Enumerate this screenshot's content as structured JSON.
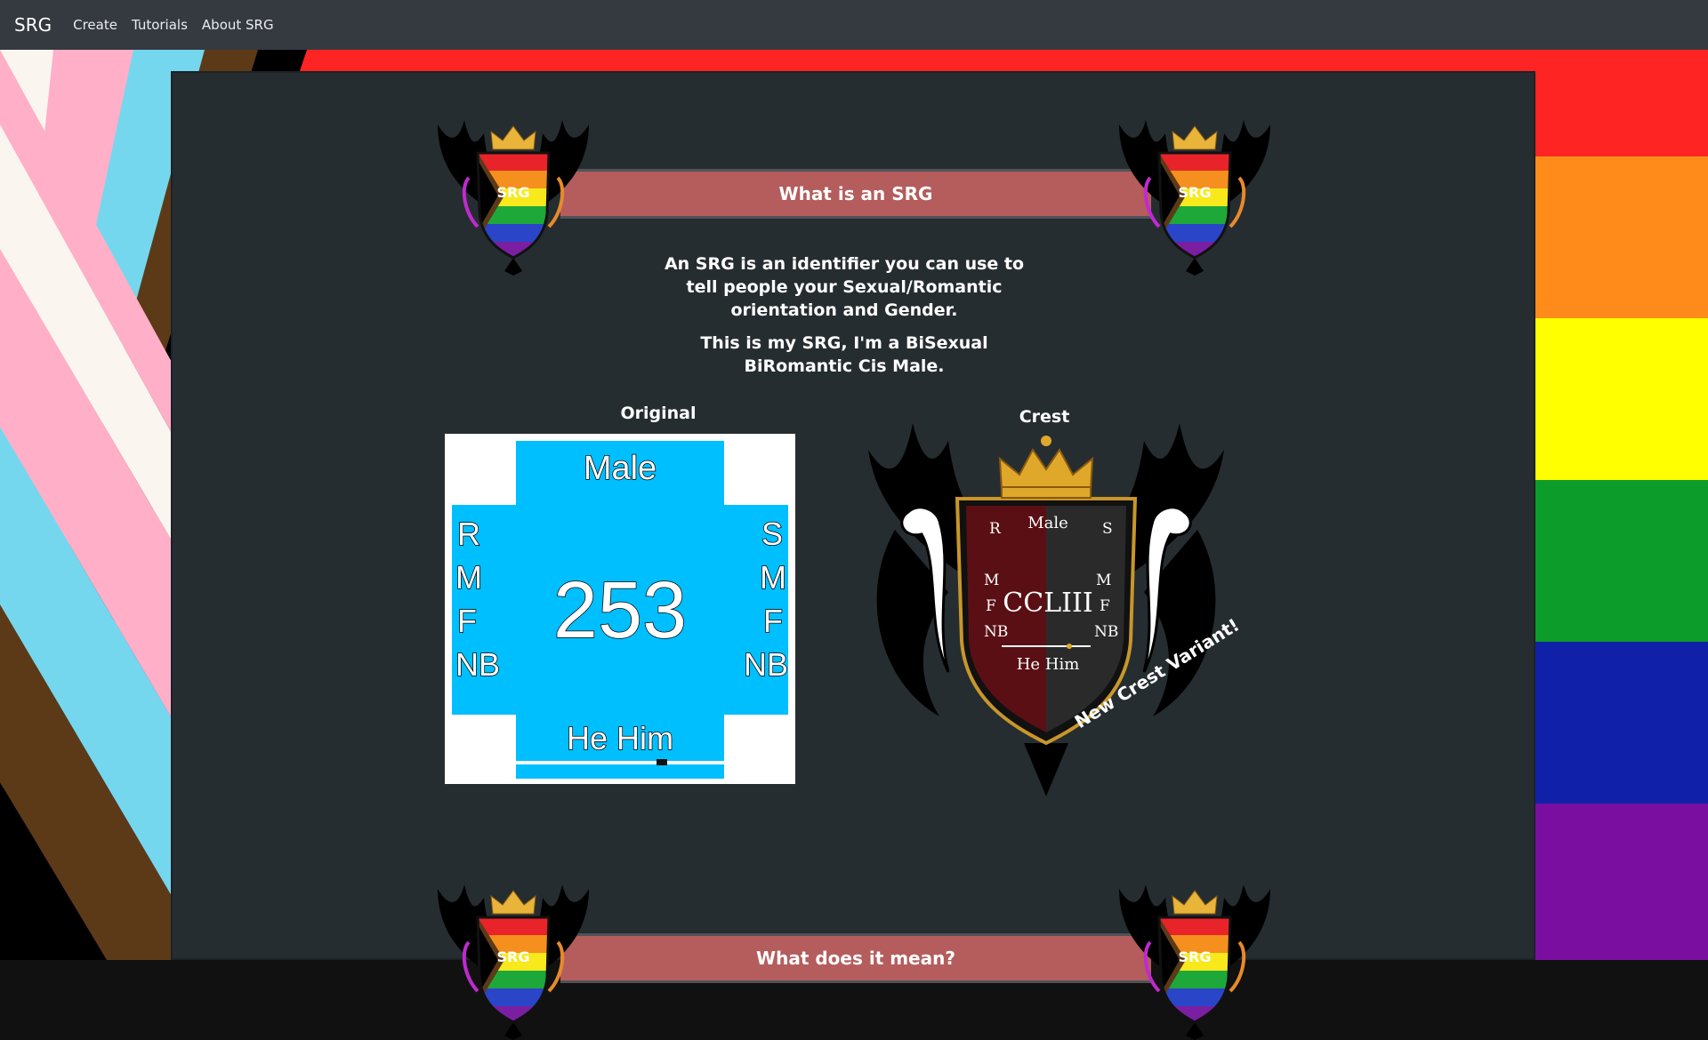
{
  "navbar": {
    "brand": "SRG",
    "links": [
      "Create",
      "Tutorials",
      "About SRG"
    ]
  },
  "section1": {
    "heading": "What is an SRG",
    "crest_label": "SRG",
    "intro_line1": "An SRG is an identifier you can use to tell people your Sexual/Romantic orientation and Gender.",
    "intro_line2": "This is my SRG, I'm a BiSexual BiRomantic Cis Male."
  },
  "section2": {
    "heading": "What does it mean?",
    "crest_label": "SRG"
  },
  "original": {
    "label": "Original",
    "gender": "Male",
    "number": "253",
    "left_letters": [
      "R",
      "M",
      "F",
      "NB"
    ],
    "right_letters": [
      "S",
      "M",
      "F",
      "NB"
    ],
    "pronouns": "He Him",
    "fill_color": "#00bfff"
  },
  "crest": {
    "label": "Crest",
    "gender": "Male",
    "numeral": "CCLIII",
    "left_letters": [
      "R",
      "M",
      "F",
      "NB"
    ],
    "right_letters": [
      "S",
      "M",
      "F",
      "NB"
    ],
    "pronouns": "He Him",
    "new_variant_note": "New Crest Variant!"
  },
  "colors": {
    "navbar": "#343a40",
    "card": "#262d31",
    "banner": "#b55c5c",
    "srg_blue": "#00bfff"
  }
}
